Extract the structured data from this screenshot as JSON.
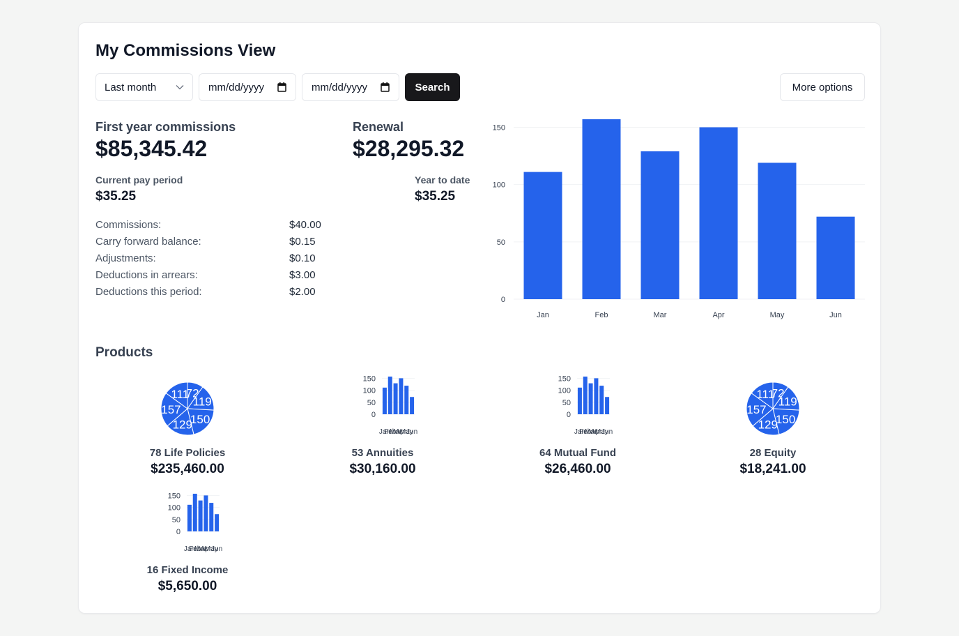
{
  "header": {
    "title": "My Commissions View"
  },
  "filters": {
    "range_value": "Last month",
    "date_from_placeholder": "mm/dd/yyyy",
    "date_to_placeholder": "mm/dd/yyyy",
    "search_label": "Search",
    "more_label": "More options"
  },
  "summary": {
    "first_year_label": "First year commissions",
    "first_year_value": "$85,345.42",
    "renewal_label": "Renewal",
    "renewal_value": "$28,295.32",
    "current_label": "Current pay period",
    "current_value": "$35.25",
    "ytd_label": "Year to date",
    "ytd_value": "$35.25",
    "rows": [
      {
        "label": "Commissions:",
        "value": "$40.00"
      },
      {
        "label": "Carry forward balance:",
        "value": "$0.15"
      },
      {
        "label": "Adjustments:",
        "value": "$0.10"
      },
      {
        "label": "Deductions in arrears:",
        "value": "$3.00"
      },
      {
        "label": "Deductions this period:",
        "value": "$2.00"
      }
    ]
  },
  "products": {
    "title": "Products",
    "items": [
      {
        "name": "78 Life Policies",
        "amount": "$235,460.00",
        "chart": "pie"
      },
      {
        "name": "53 Annuities",
        "amount": "$30,160.00",
        "chart": "bar"
      },
      {
        "name": "64 Mutual Fund",
        "amount": "$26,460.00",
        "chart": "bar"
      },
      {
        "name": "28 Equity",
        "amount": "$18,241.00",
        "chart": "pie"
      },
      {
        "name": "16 Fixed Income",
        "amount": "$5,650.00",
        "chart": "bar"
      }
    ]
  },
  "colors": {
    "accent": "#2563eb",
    "button_dark": "#18181b"
  },
  "icons": {
    "select": "chevron-down-icon",
    "date": "calendar-icon"
  },
  "chart_data": {
    "type": "bar",
    "categories": [
      "Jan",
      "Feb",
      "Mar",
      "Apr",
      "May",
      "Jun"
    ],
    "values": [
      111,
      157,
      129,
      150,
      119,
      72
    ],
    "yticks": [
      0,
      50,
      100,
      150
    ],
    "ylim": [
      0,
      157
    ],
    "grid": true,
    "color": "#2563eb"
  }
}
